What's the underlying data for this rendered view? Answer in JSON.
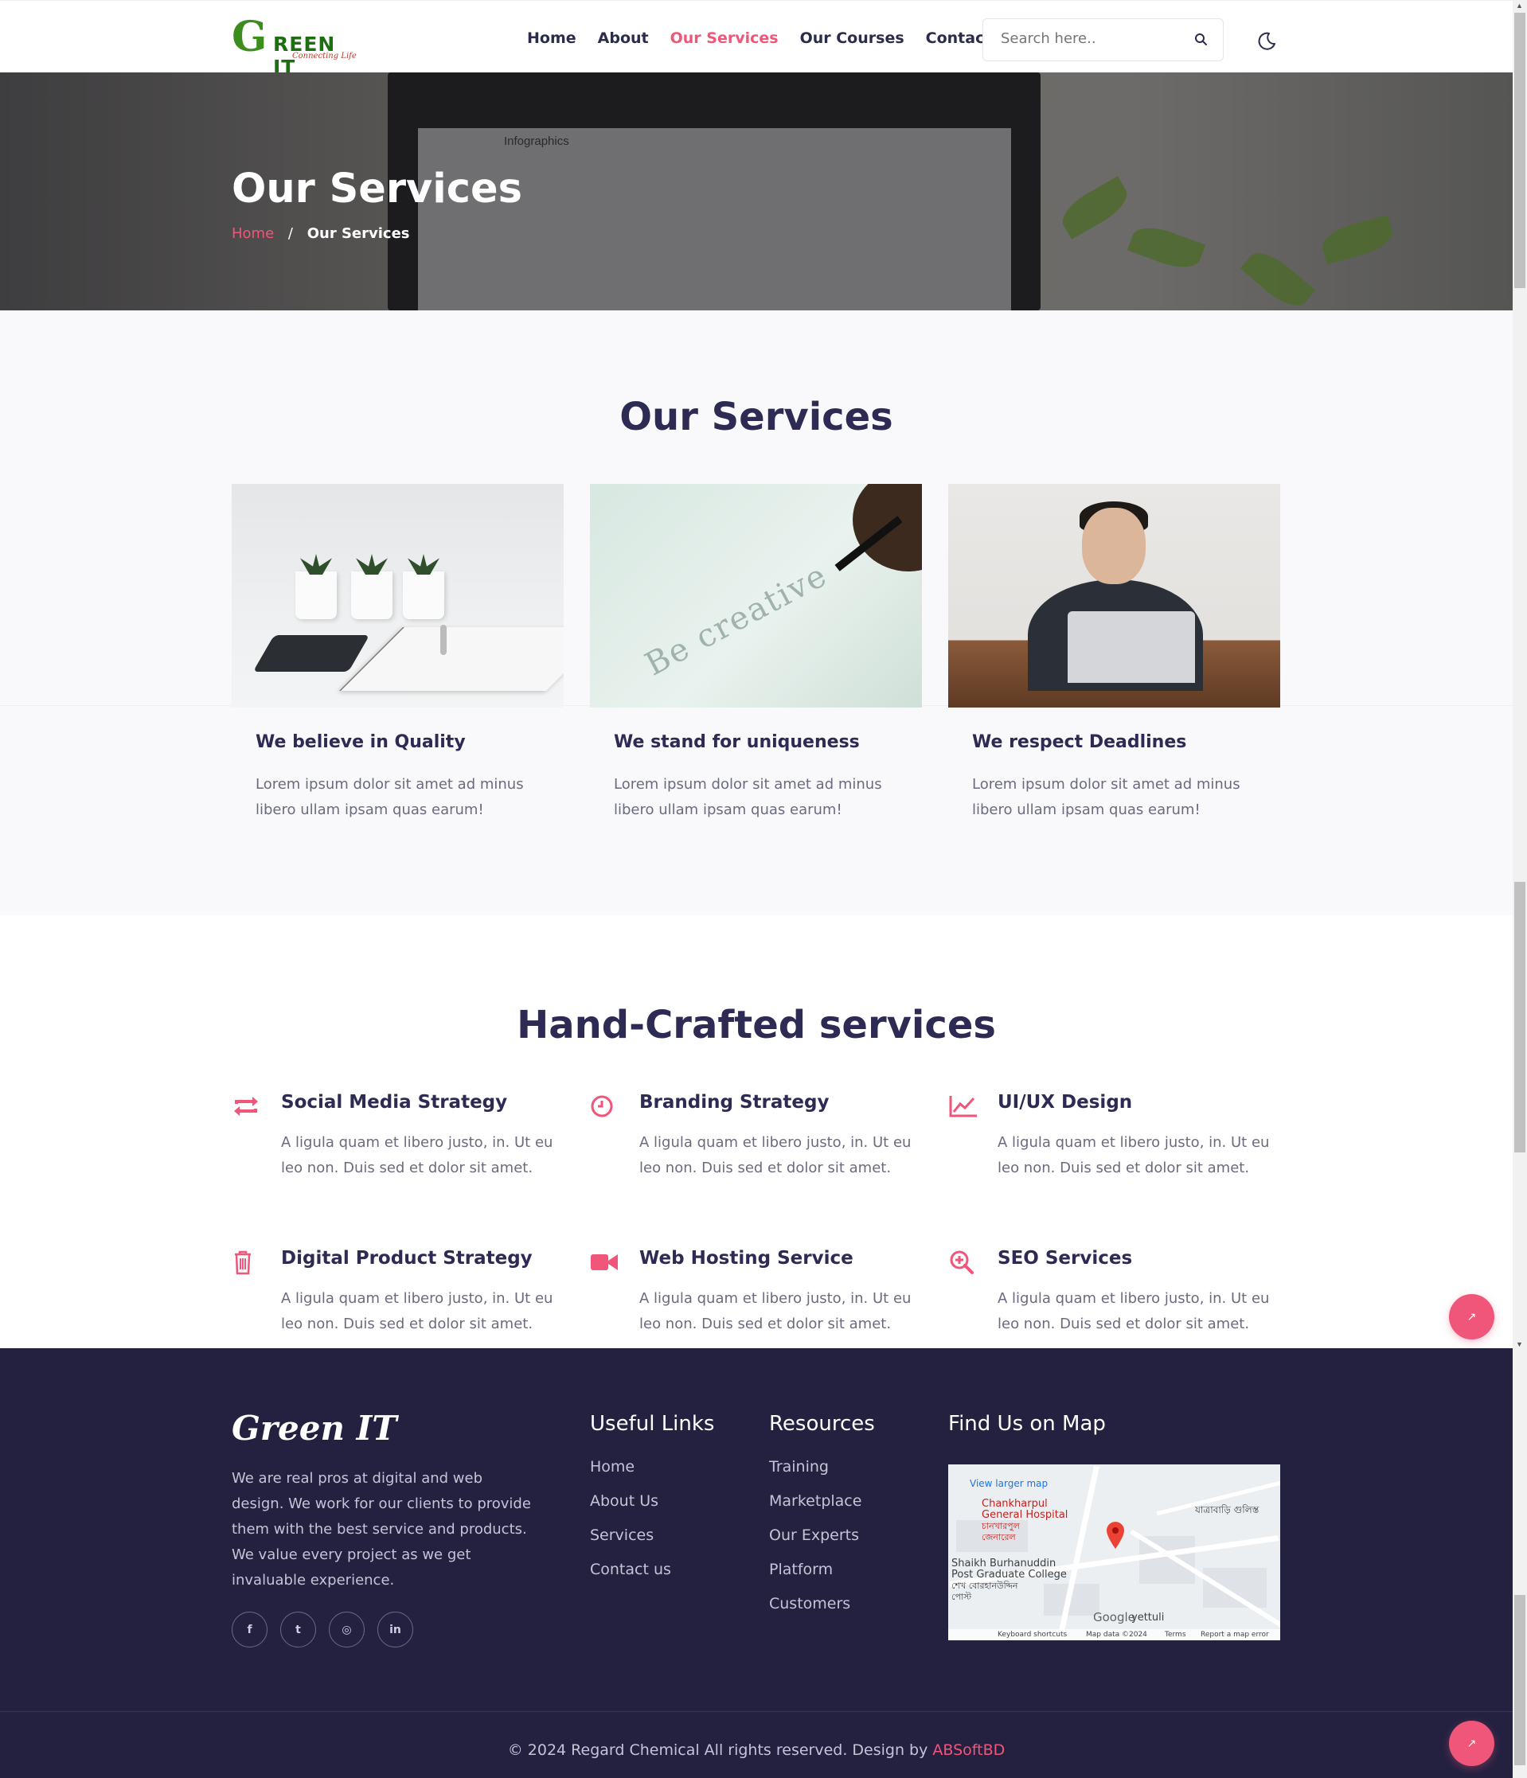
{
  "header": {
    "logo": {
      "letter": "G",
      "text": "REEN IT",
      "tagline": "Connecting Life"
    },
    "nav": [
      "Home",
      "About",
      "Our Services",
      "Our Courses",
      "Contact"
    ],
    "active_nav": "Our Services",
    "search_placeholder": "Search here..",
    "theme_icon": "moon-icon"
  },
  "hero": {
    "title": "Our Services",
    "screen_text": "Infographics",
    "breadcrumb": {
      "home": "Home",
      "separator": "/",
      "current": "Our Services"
    }
  },
  "services": {
    "heading": "Our Services",
    "cards": [
      {
        "title": "We believe in Quality",
        "text": "Lorem ipsum dolor sit amet ad minus libero ullam ipsam quas earum!"
      },
      {
        "title": "We stand for uniqueness",
        "text": "Lorem ipsum dolor sit amet ad minus libero ullam ipsam quas earum!",
        "image_text": "Be creative"
      },
      {
        "title": "We respect Deadlines",
        "text": "Lorem ipsum dolor sit amet ad minus libero ullam ipsam quas earum!"
      }
    ]
  },
  "handcrafted": {
    "heading": "Hand-Crafted services",
    "items": [
      {
        "icon": "retweet-icon",
        "title": "Social Media Strategy",
        "text": "A ligula quam et libero justo, in. Ut eu leo non. Duis sed et dolor sit amet."
      },
      {
        "icon": "clock-icon",
        "title": "Branding Strategy",
        "text": "A ligula quam et libero justo, in. Ut eu leo non. Duis sed et dolor sit amet."
      },
      {
        "icon": "line-chart-icon",
        "title": "UI/UX Design",
        "text": "A ligula quam et libero justo, in. Ut eu leo non. Duis sed et dolor sit amet."
      },
      {
        "icon": "trash-icon",
        "title": "Digital Product Strategy",
        "text": "A ligula quam et libero justo, in. Ut eu leo non. Duis sed et dolor sit amet."
      },
      {
        "icon": "video-camera-icon",
        "title": "Web Hosting Service",
        "text": "A ligula quam et libero justo, in. Ut eu leo non. Duis sed et dolor sit amet."
      },
      {
        "icon": "zoom-in-icon",
        "title": "SEO Services",
        "text": "A ligula quam et libero justo, in. Ut eu leo non. Duis sed et dolor sit amet."
      }
    ]
  },
  "footer": {
    "logo": "Green IT",
    "about": "We are real pros at digital and web design. We work for our clients to provide them with the best service and products. We value every project as we get invaluable experience.",
    "socials": [
      {
        "icon": "facebook-icon",
        "glyph": "f"
      },
      {
        "icon": "twitter-icon",
        "glyph": "t"
      },
      {
        "icon": "instagram-icon",
        "glyph": "◎"
      },
      {
        "icon": "linkedin-icon",
        "glyph": "in"
      }
    ],
    "useful_links": {
      "title": "Useful Links",
      "items": [
        "Home",
        "About Us",
        "Services",
        "Contact us"
      ]
    },
    "resources": {
      "title": "Resources",
      "items": [
        "Training",
        "Marketplace",
        "Our Experts",
        "Platform",
        "Customers"
      ]
    },
    "map": {
      "title": "Find Us on Map",
      "view_larger": "View larger map",
      "places": [
        "Chankharpul",
        "General Hospital",
        "চানখারপুল",
        "জেনারেল",
        "Shaikh Burhanuddin",
        "Post Graduate College",
        "শেখ বোরহানউদ্দিন",
        "পোস্ট",
        "যাত্রাবাড়ি গুলিস্ত",
        "yettuli"
      ],
      "google": "Google",
      "footer_items": [
        "Keyboard shortcuts",
        "Map data ©2024",
        "Terms",
        "Report a map error"
      ]
    },
    "copyright": "© 2024 Regard Chemical All rights reserved. Design by",
    "designer": "ABSoftBD"
  },
  "colors": {
    "accent": "#f0567a",
    "heading": "#2d2a54",
    "footer_bg": "#242140",
    "logo_green": "#3b8e1e"
  },
  "floating": {
    "back_to_top_icon": "arrow-up-icon"
  }
}
